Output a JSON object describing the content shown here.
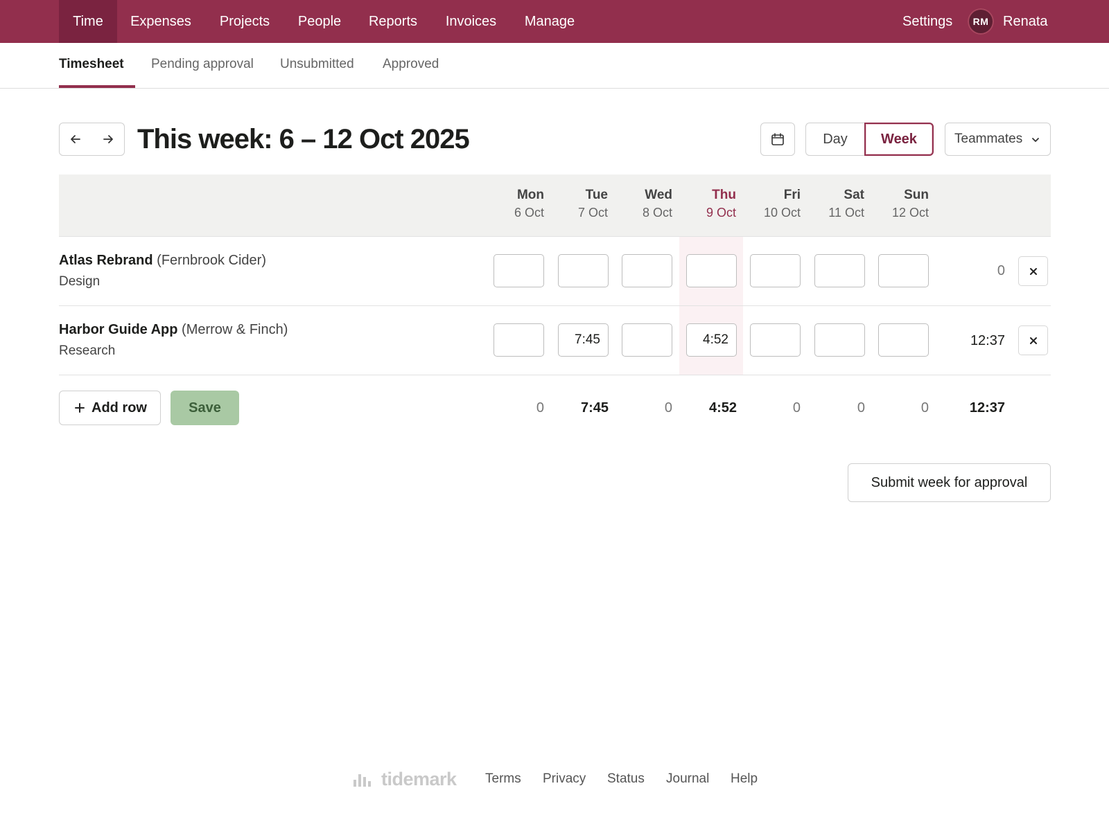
{
  "nav": {
    "tabs": [
      {
        "label": "Time",
        "active": true
      },
      {
        "label": "Expenses"
      },
      {
        "label": "Projects"
      },
      {
        "label": "People"
      },
      {
        "label": "Reports"
      },
      {
        "label": "Invoices"
      },
      {
        "label": "Manage"
      }
    ],
    "settings": "Settings",
    "avatar_initials": "RM",
    "user_name": "Renata"
  },
  "subnav": {
    "tabs": [
      {
        "label": "Timesheet",
        "active": true
      },
      {
        "label": "Pending approval"
      },
      {
        "label": "Unsubmitted"
      },
      {
        "label": "Approved"
      }
    ]
  },
  "header": {
    "title": "This week: 6 – 12 Oct 2025",
    "view_day": "Day",
    "view_week": "Week",
    "view_selected": "Week",
    "teammates": "Teammates"
  },
  "days": [
    {
      "name": "Mon",
      "date": "6 Oct"
    },
    {
      "name": "Tue",
      "date": "7 Oct"
    },
    {
      "name": "Wed",
      "date": "8 Oct"
    },
    {
      "name": "Thu",
      "date": "9 Oct",
      "today": true
    },
    {
      "name": "Fri",
      "date": "10 Oct"
    },
    {
      "name": "Sat",
      "date": "11 Oct"
    },
    {
      "name": "Sun",
      "date": "12 Oct"
    }
  ],
  "rows": [
    {
      "project": "Atlas Rebrand",
      "client": "(Fernbrook Cider)",
      "task": "Design",
      "hours": [
        "",
        "",
        "",
        "",
        "",
        "",
        ""
      ],
      "total": "0"
    },
    {
      "project": "Harbor Guide App",
      "client": "(Merrow & Finch)",
      "task": "Research",
      "hours": [
        "",
        "7:45",
        "",
        "4:52",
        "",
        "",
        ""
      ],
      "total": "12:37"
    }
  ],
  "actions": {
    "add_row": "Add row",
    "save": "Save",
    "submit": "Submit week for approval"
  },
  "totals": {
    "days": [
      "0",
      "7:45",
      "0",
      "4:52",
      "0",
      "0",
      "0"
    ],
    "grand": "12:37"
  },
  "footer": {
    "brand": "tidemark",
    "links": [
      "Terms",
      "Privacy",
      "Status",
      "Journal",
      "Help"
    ]
  },
  "colors": {
    "brand": "#922f4d",
    "today_highlight": "#fbf1f3",
    "save_disabled": "#a9c9a4"
  }
}
